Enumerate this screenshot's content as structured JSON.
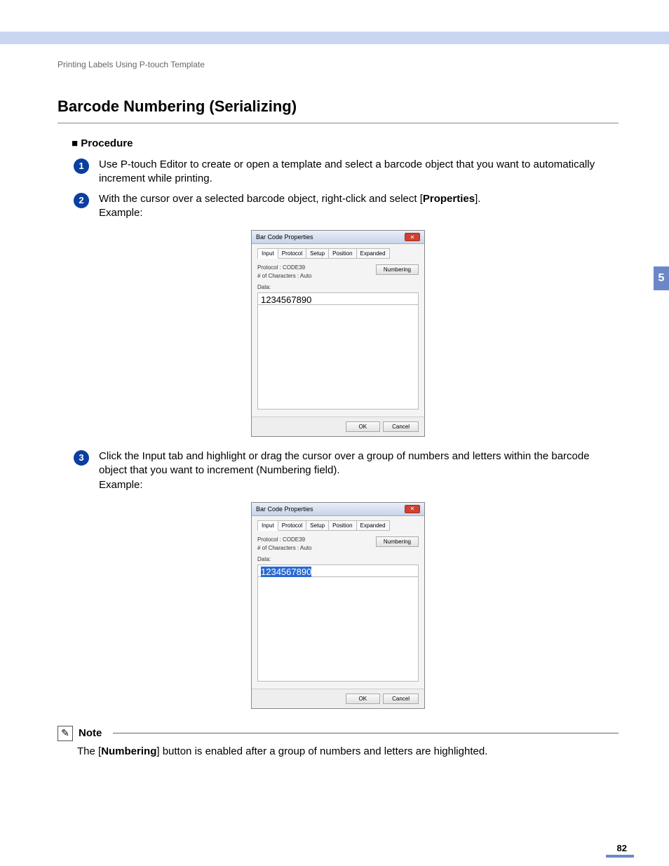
{
  "breadcrumb": "Printing Labels Using P-touch Template",
  "section_title": "Barcode Numbering (Serializing)",
  "procedure_label": "Procedure",
  "steps": {
    "s1": "Use P-touch Editor to create or open a template and select a barcode object that you want to automatically increment while printing.",
    "s2_a": "With the cursor over a selected barcode object, right-click and select [",
    "s2_b": "Properties",
    "s2_c": "].",
    "s2_d": "Example:",
    "s3_a": "Click the Input tab and highlight or drag the cursor over a group of numbers and letters within the barcode object that you want to increment (Numbering field).",
    "s3_b": "Example:"
  },
  "dialog": {
    "title": "Bar Code Properties",
    "tabs": {
      "input": "Input",
      "protocol": "Protocol",
      "setup": "Setup",
      "position": "Position",
      "expanded": "Expanded"
    },
    "protocol": "Protocol : CODE39",
    "chars": "# of Characters : Auto",
    "numbering_btn": "Numbering",
    "data_label": "Data:",
    "data_value": "1234567890",
    "ok": "OK",
    "cancel": "Cancel"
  },
  "note": {
    "label": "Note",
    "text_a": "The [",
    "text_b": "Numbering",
    "text_c": "] button is enabled after a group of numbers and letters are highlighted."
  },
  "chapter": "5",
  "page": "82"
}
